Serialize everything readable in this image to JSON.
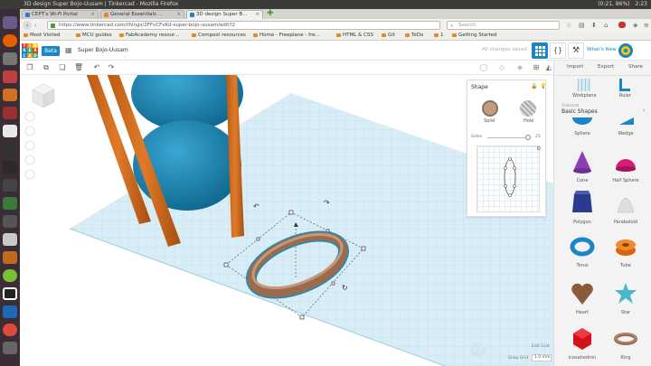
{
  "os": {
    "window_title": "3D design Super Bojo-Uusam | Tinkercad - Mozilla Firefox",
    "tray": [
      "(0:21, 86%)",
      "2:23"
    ]
  },
  "browser": {
    "tabs": [
      {
        "label": "CEPT's Wi-Fi Portal"
      },
      {
        "label": "General Essentials ..."
      },
      {
        "label": "3D design Super B..."
      }
    ],
    "url": "https://www.tinkercad.com/things/2FFvCFvKd-super-bojo-uusam/edit?2",
    "search_placeholder": "Search",
    "bookmarks": [
      "Most Visited",
      "MCU guides",
      "FabAcademy resour...",
      "Compost resources",
      "Home - Freeplane - fre...",
      "HTML & CSS",
      "Git",
      "ToDo",
      "1",
      "Getting Started"
    ]
  },
  "tinkercad": {
    "logo_letters": [
      "T",
      "I",
      "N",
      "K",
      "E",
      "R",
      "C",
      "A",
      "D"
    ],
    "beta": "Beta",
    "design_name": "Super Bojo-Uusam",
    "status": "All changes saved",
    "whats_new": "What's New",
    "actions": [
      "Import",
      "Export",
      "Share"
    ],
    "colors": {
      "accent": "#1a86c6",
      "sphere": "#1e8bb8",
      "rod": "#d2691e",
      "ring": "#9a6b4f"
    }
  },
  "panel": {
    "workplane": "Workplane",
    "ruler": "Ruler",
    "category_caption": "Tinkercad",
    "category": "Basic Shapes",
    "shapes": [
      "Sphere",
      "Wedge",
      "Cone",
      "Half Sphere",
      "Polygon",
      "Paraboloid",
      "Torus",
      "Tube",
      "Heart",
      "Star",
      "Icosahedron",
      "Ring"
    ]
  },
  "inspector": {
    "title": "Shape",
    "solid": "Solid",
    "hole": "Hole",
    "sides_label": "Sides",
    "sides_value": "25"
  },
  "viewport": {
    "edit_grid": "Edit Grid",
    "snap_label": "Snap Grid",
    "snap_value": "1.0 mm"
  }
}
